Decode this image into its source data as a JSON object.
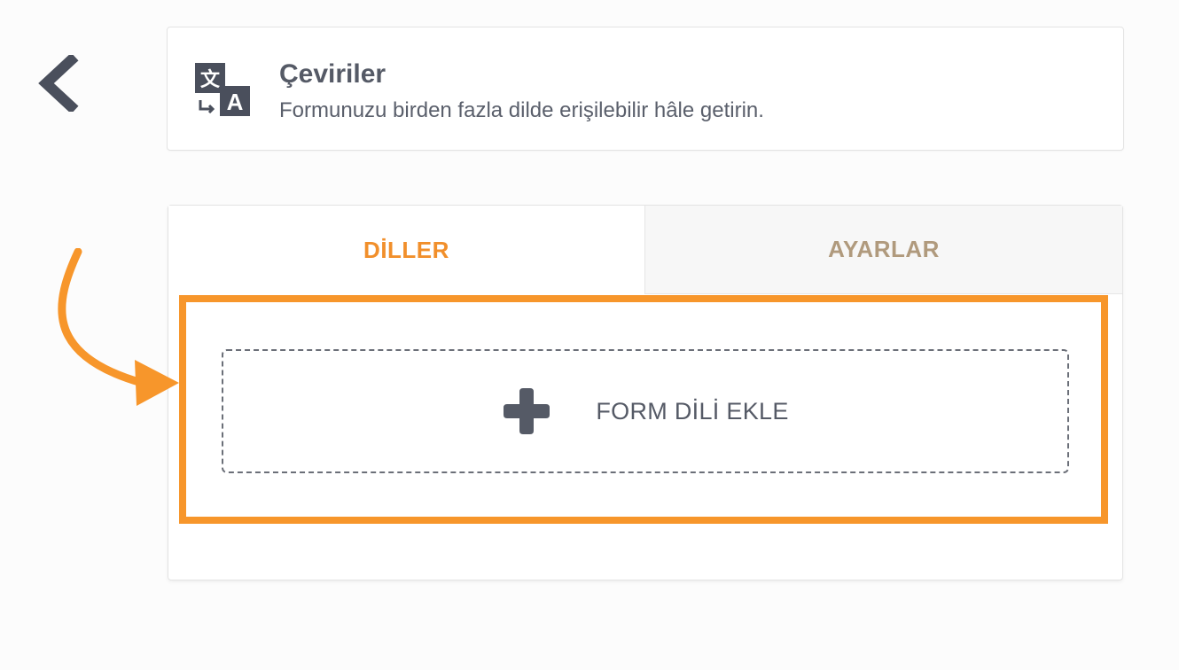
{
  "header": {
    "title": "Çeviriler",
    "subtitle": "Formunuzu birden fazla dilde erişilebilir hâle getirin.",
    "icon": "translate-icon"
  },
  "tabs": [
    {
      "label": "DİLLER",
      "active": true
    },
    {
      "label": "AYARLAR",
      "active": false
    }
  ],
  "add_language": {
    "label": "FORM DİLİ EKLE",
    "icon": "plus-icon"
  },
  "colors": {
    "accent": "#f7962b",
    "tab_active": "#f18f2b",
    "tab_inactive": "#b09a7d",
    "text_dark": "#555a66"
  }
}
